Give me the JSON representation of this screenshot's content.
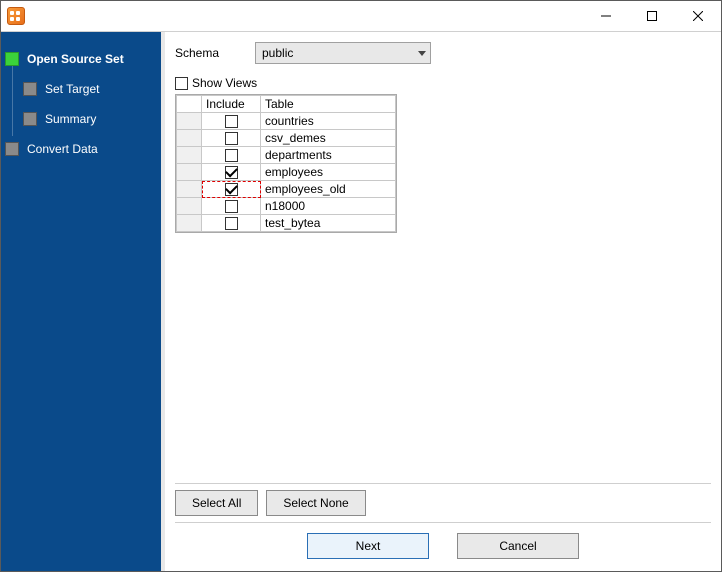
{
  "title": "",
  "window": {
    "min_icon": "minimize-icon",
    "max_icon": "maximize-icon",
    "close_icon": "close-icon"
  },
  "sidebar": {
    "items": [
      {
        "label": "Open Source Set",
        "active": true,
        "sub": false
      },
      {
        "label": "Set Target",
        "active": false,
        "sub": true
      },
      {
        "label": "Summary",
        "active": false,
        "sub": true
      },
      {
        "label": "Convert Data",
        "active": false,
        "sub": false
      }
    ]
  },
  "schema": {
    "label": "Schema",
    "selected": "public"
  },
  "show_views": {
    "label": "Show Views",
    "checked": false
  },
  "grid": {
    "headers": {
      "include": "Include",
      "table": "Table"
    },
    "rows": [
      {
        "include": false,
        "table": "countries"
      },
      {
        "include": false,
        "table": "csv_demes"
      },
      {
        "include": false,
        "table": "departments"
      },
      {
        "include": true,
        "table": "employees"
      },
      {
        "include": true,
        "table": "employees_old",
        "focus": true
      },
      {
        "include": false,
        "table": "n18000"
      },
      {
        "include": false,
        "table": "test_bytea"
      }
    ]
  },
  "buttons": {
    "select_all": "Select All",
    "select_none": "Select None",
    "next": "Next",
    "cancel": "Cancel"
  }
}
